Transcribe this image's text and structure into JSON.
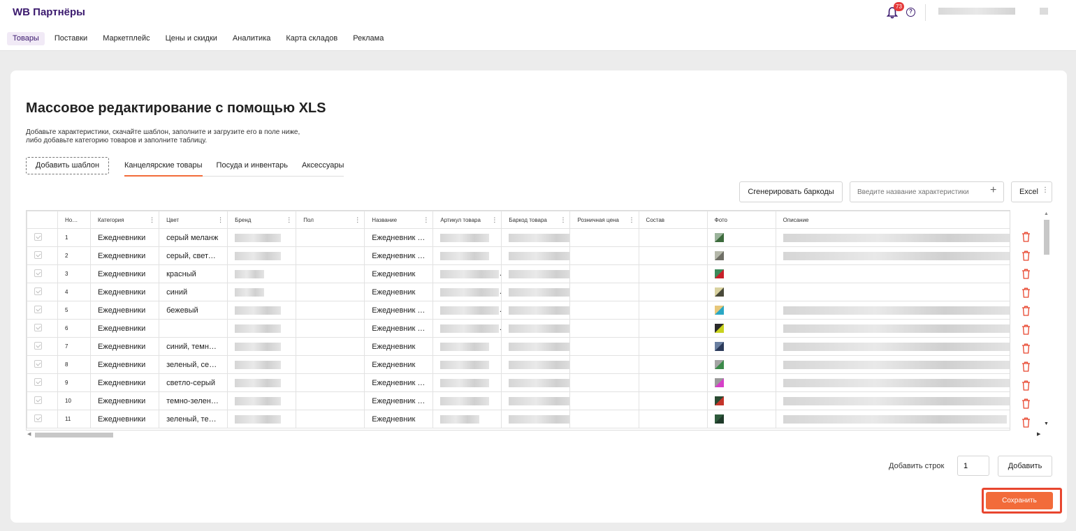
{
  "app": {
    "title": "WB Партнёры",
    "notifications_count": "73"
  },
  "nav": {
    "items": [
      {
        "label": "Товары",
        "active": true
      },
      {
        "label": "Поставки",
        "active": false
      },
      {
        "label": "Маркетплейс",
        "active": false
      },
      {
        "label": "Цены и скидки",
        "active": false
      },
      {
        "label": "Аналитика",
        "active": false
      },
      {
        "label": "Карта складов",
        "active": false
      },
      {
        "label": "Реклама",
        "active": false
      }
    ]
  },
  "page": {
    "title": "Массовое редактирование с помощью XLS",
    "description": "Добавьте характеристики, скачайте шаблон, заполните и загрузите его в поле ниже, либо добавьте категорию товаров и заполните таблицу.",
    "add_template_label": "Добавить шаблон",
    "template_tabs": [
      {
        "label": "Канцелярские товары",
        "active": true
      },
      {
        "label": "Посуда и инвентарь",
        "active": false
      },
      {
        "label": "Аксессуары",
        "active": false
      }
    ]
  },
  "toolbar": {
    "generate_label": "Сгенерировать баркоды",
    "characteristic_placeholder": "Введите название характеристики",
    "excel_label": "Excel"
  },
  "table": {
    "columns": [
      "Ном...",
      "Категория",
      "Цвет",
      "Бренд",
      "Пол",
      "Название",
      "Артикул товара",
      "Баркод товара",
      "Розничная цена",
      "Состав",
      "Фото",
      "Описание"
    ],
    "rows": [
      {
        "num": "1",
        "category": "Ежедневники",
        "color": "серый меланж",
        "name": "Ежедневник на",
        "photo": [
          "#3c6b3c",
          "#9bb39b"
        ]
      },
      {
        "num": "2",
        "category": "Ежедневники",
        "color": "серый, светло-серый",
        "name": "Ежедневник на",
        "photo": [
          "#6f6f66",
          "#b5b8aa"
        ]
      },
      {
        "num": "3",
        "category": "Ежедневники",
        "color": "красный",
        "name": "Ежедневник",
        "photo": [
          "#c8202a",
          "#3c8a5a"
        ]
      },
      {
        "num": "4",
        "category": "Ежедневники",
        "color": "синий",
        "name": "Ежедневник",
        "photo": [
          "#4a4a3a",
          "#d9d2a0"
        ]
      },
      {
        "num": "5",
        "category": "Ежедневники",
        "color": "бежевый",
        "name": "Ежедневник на",
        "photo": [
          "#2aa7c4",
          "#e7c77a"
        ]
      },
      {
        "num": "6",
        "category": "Ежедневники",
        "color": "",
        "name": "Ежедневник на",
        "photo": [
          "#c9d31f",
          "#2b2b2b"
        ]
      },
      {
        "num": "7",
        "category": "Ежедневники",
        "color": "синий, темно-синий",
        "name": "Ежедневник",
        "photo": [
          "#2b3a5a",
          "#6a7fa0"
        ]
      },
      {
        "num": "8",
        "category": "Ежедневники",
        "color": "зеленый, серый",
        "name": "Ежедневник",
        "photo": [
          "#3c8a4a",
          "#a4a4a4"
        ]
      },
      {
        "num": "9",
        "category": "Ежедневники",
        "color": "светло-серый",
        "name": "Ежедневник на",
        "photo": [
          "#d640c8",
          "#9a9a9a"
        ]
      },
      {
        "num": "10",
        "category": "Ежедневники",
        "color": "темно-зеленый",
        "name": "Ежедневник на",
        "photo": [
          "#c4342a",
          "#2a4a32"
        ]
      },
      {
        "num": "11",
        "category": "Ежедневники",
        "color": "зеленый, темно-зеленый",
        "name": "Ежедневник",
        "photo": [
          "#1f3a2a",
          "#2e5a3c"
        ]
      }
    ]
  },
  "footer": {
    "add_rows_label": "Добавить строк",
    "add_rows_value": "1",
    "add_label": "Добавить",
    "save_label": "Сохранить"
  },
  "colors": {
    "accent": "#f26b3a",
    "brand": "#3b1a6e",
    "highlight": "#e8462f"
  }
}
